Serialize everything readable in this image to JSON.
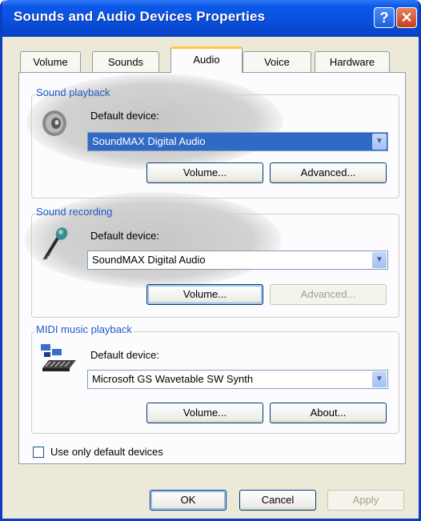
{
  "window": {
    "title": "Sounds and Audio Devices Properties",
    "help_glyph": "?",
    "close_glyph": "✕"
  },
  "tabs": [
    {
      "label": "Volume",
      "active": false
    },
    {
      "label": "Sounds",
      "active": false
    },
    {
      "label": "Audio",
      "active": true
    },
    {
      "label": "Voice",
      "active": false
    },
    {
      "label": "Hardware",
      "active": false
    }
  ],
  "playback": {
    "legend": "Sound playback",
    "icon": "speaker-icon",
    "default_label": "Default device:",
    "device": "SoundMAX Digital Audio",
    "volume_label": "Volume...",
    "advanced_label": "Advanced..."
  },
  "recording": {
    "legend": "Sound recording",
    "icon": "microphone-icon",
    "default_label": "Default device:",
    "device": "SoundMAX Digital Audio",
    "volume_label": "Volume...",
    "advanced_label": "Advanced..."
  },
  "midi": {
    "legend": "MIDI music playback",
    "icon": "midi-keyboard-icon",
    "default_label": "Default device:",
    "device": "Microsoft GS Wavetable SW Synth",
    "volume_label": "Volume...",
    "about_label": "About..."
  },
  "use_default_only": {
    "label": "Use only default devices",
    "checked": false
  },
  "footer": {
    "ok_label": "OK",
    "cancel_label": "Cancel",
    "apply_label": "Apply"
  },
  "colors": {
    "title_blue": "#0a4fdc",
    "legend_blue": "#1c5ac6",
    "selection": "#316ac5",
    "face": "#ece9d8"
  }
}
